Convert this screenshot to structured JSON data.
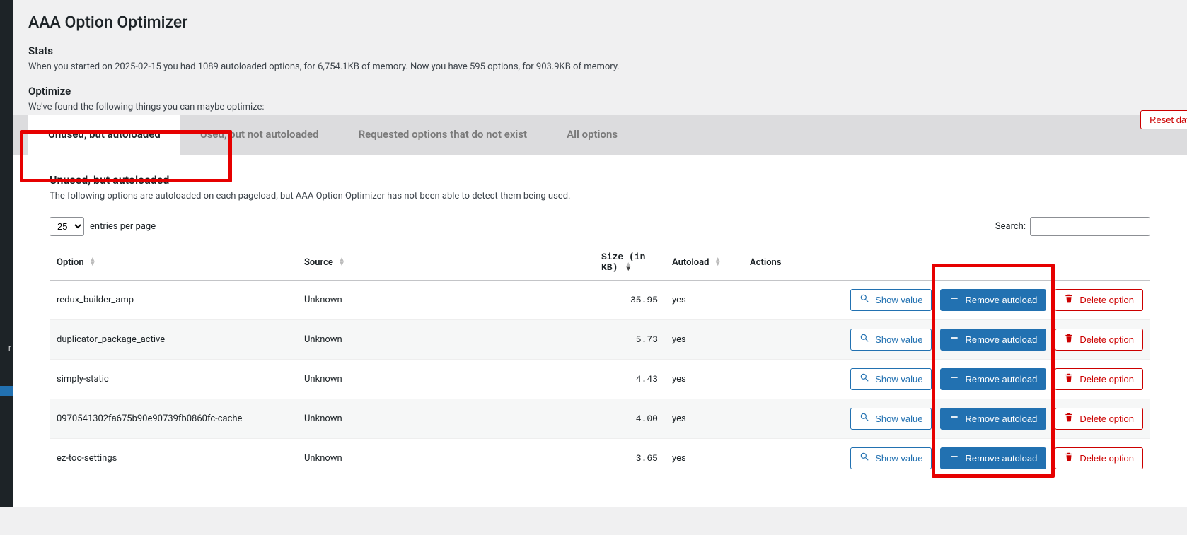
{
  "page_title": "AAA Option Optimizer",
  "stats_heading": "Stats",
  "stats_text": "When you started on 2025-02-15 you had 1089 autoloaded options, for 6,754.1KB of memory. Now you have 595 options, for 903.9KB of memory.",
  "optimize_heading": "Optimize",
  "optimize_text": "We've found the following things you can maybe optimize:",
  "reset_label": "Reset data",
  "tabs": [
    {
      "label": "Unused, but autoloaded",
      "active": true
    },
    {
      "label": "Used, but not autoloaded",
      "active": false
    },
    {
      "label": "Requested options that do not exist",
      "active": false
    },
    {
      "label": "All options",
      "active": false
    }
  ],
  "panel": {
    "heading": "Unused, but autoloaded",
    "desc": "The following options are autoloaded on each pageload, but AAA Option Optimizer has not been able to detect them being used.",
    "entries_value": "25",
    "entries_label": "entries per page",
    "search_label": "Search:",
    "search_value": ""
  },
  "columns": {
    "option": "Option",
    "source": "Source",
    "size": "Size (in KB)",
    "autoload": "Autoload",
    "actions": "Actions"
  },
  "row_buttons": {
    "show": "Show value",
    "remove": "Remove autoload",
    "delete": "Delete option"
  },
  "rows": [
    {
      "option": "redux_builder_amp",
      "source": "Unknown",
      "size": "35.95",
      "autoload": "yes"
    },
    {
      "option": "duplicator_package_active",
      "source": "Unknown",
      "size": "5.73",
      "autoload": "yes"
    },
    {
      "option": "simply-static",
      "source": "Unknown",
      "size": "4.43",
      "autoload": "yes"
    },
    {
      "option": "0970541302fa675b90e90739fb0860fc-cache",
      "source": "Unknown",
      "size": "4.00",
      "autoload": "yes"
    },
    {
      "option": "ez-toc-settings",
      "source": "Unknown",
      "size": "3.65",
      "autoload": "yes"
    }
  ]
}
